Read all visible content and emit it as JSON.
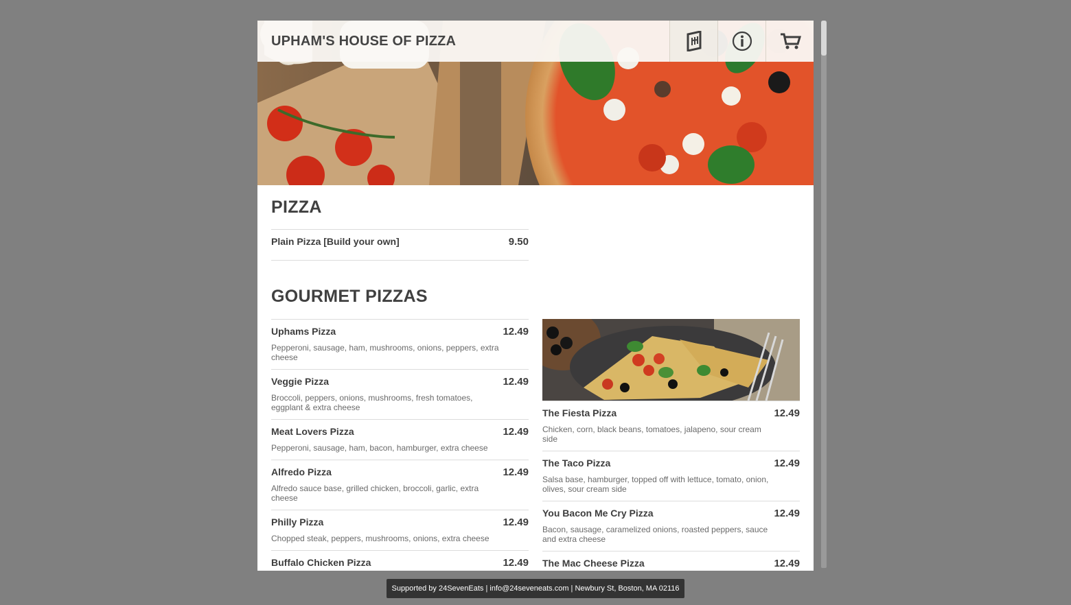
{
  "header": {
    "title": "UPHAM'S HOUSE OF PIZZA",
    "icons": [
      "menu-book-icon",
      "info-icon",
      "cart-icon"
    ]
  },
  "sections": {
    "pizza": {
      "title": "PIZZA",
      "items": [
        {
          "name": "Plain Pizza [Build your own]",
          "price": "9.50",
          "desc": ""
        }
      ]
    },
    "gourmet": {
      "title": "GOURMET PIZZAS",
      "left": [
        {
          "name": "Uphams Pizza",
          "price": "12.49",
          "desc": "Pepperoni, sausage, ham, mushrooms, onions, peppers, extra cheese"
        },
        {
          "name": "Veggie Pizza",
          "price": "12.49",
          "desc": "Broccoli, peppers, onions, mushrooms, fresh tomatoes, eggplant & extra cheese"
        },
        {
          "name": "Meat Lovers Pizza",
          "price": "12.49",
          "desc": "Pepperoni, sausage, ham, bacon, hamburger, extra cheese"
        },
        {
          "name": "Alfredo Pizza",
          "price": "12.49",
          "desc": "Alfredo sauce base, grilled chicken, broccoli, garlic, extra cheese"
        },
        {
          "name": "Philly Pizza",
          "price": "12.49",
          "desc": "Chopped steak, peppers, mushrooms, onions, extra cheese"
        },
        {
          "name": "Buffalo Chicken Pizza",
          "price": "12.49",
          "desc": ""
        }
      ],
      "right": [
        {
          "name": "The Fiesta Pizza",
          "price": "12.49",
          "desc": "Chicken, corn, black beans, tomatoes, jalapeno, sour cream side"
        },
        {
          "name": "The Taco Pizza",
          "price": "12.49",
          "desc": "Salsa base, hamburger, topped off with lettuce, tomato, onion, olives, sour cream side"
        },
        {
          "name": "You Bacon Me Cry Pizza",
          "price": "12.49",
          "desc": "Bacon, sausage, caramelized onions, roasted peppers, sauce and extra cheese"
        },
        {
          "name": "The Mac Cheese Pizza",
          "price": "12.49",
          "desc": ""
        }
      ]
    }
  },
  "footer": {
    "text": "Supported by 24SevenEats | info@24seveneats.com | Newbury St, Boston, MA 02116"
  },
  "colors": {
    "backdrop": "#808080",
    "text": "#404040",
    "footer_bg": "#333333"
  }
}
